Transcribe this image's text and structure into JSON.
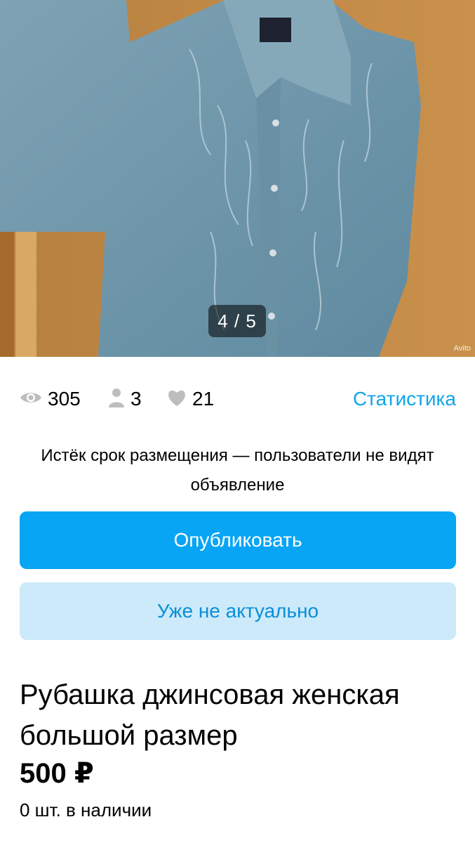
{
  "gallery": {
    "counter": "4 / 5",
    "watermark": "Avito"
  },
  "stats": {
    "views": "305",
    "contacts": "3",
    "favorites": "21",
    "link_label": "Статистика",
    "icons": [
      "eye-icon",
      "person-icon",
      "heart-icon"
    ],
    "icon_color": "#bdbdbd"
  },
  "notice": {
    "text": "Истёк срок размещения — пользователи не видят объявление"
  },
  "actions": {
    "publish_label": "Опубликовать",
    "obsolete_label": "Уже не актуально"
  },
  "listing": {
    "title": "Рубашка джинсовая женская большой размер",
    "price": "500 ₽",
    "stock": "0 шт. в наличии"
  },
  "colors": {
    "accent": "#08a5f5",
    "link": "#11a5e8",
    "secondary_button_bg": "#cdeafb",
    "secondary_button_text": "#088fd6"
  }
}
